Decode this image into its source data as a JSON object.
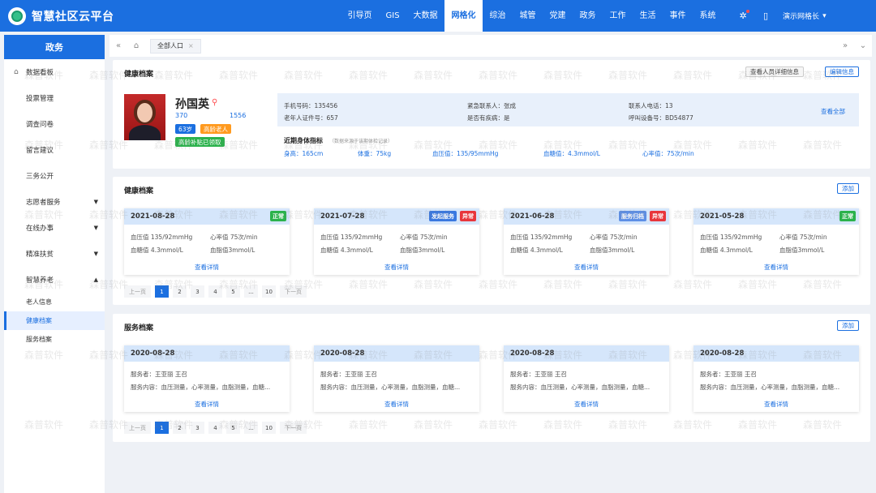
{
  "brand": {
    "title": "智慧社区云平台"
  },
  "nav": [
    "引导页",
    "GIS",
    "大数据",
    "网格化",
    "综治",
    "城管",
    "党建",
    "政务",
    "工作",
    "生活",
    "事件",
    "系统"
  ],
  "nav_active": 3,
  "user": {
    "name": "演示网格长"
  },
  "sidebar": {
    "head": "政务",
    "items": [
      {
        "label": "数据看板",
        "home": true
      },
      {
        "label": "投票管理"
      },
      {
        "label": "调查问卷"
      },
      {
        "label": "留言建议"
      },
      {
        "label": "三务公开"
      },
      {
        "label": "志愿者服务",
        "caret": "▼"
      },
      {
        "label": "在线办事",
        "caret": "▼"
      },
      {
        "label": "精准扶贫",
        "caret": "▼"
      },
      {
        "label": "智慧养老",
        "caret": "▲"
      }
    ],
    "sub_items": [
      "老人信息",
      "健康档案",
      "服务档案"
    ],
    "active_sub": 1
  },
  "tabbar": {
    "tab": "全部人口",
    "close": "×"
  },
  "profile": {
    "section_title": "健康档案",
    "btn_view": "查看人员详细信息",
    "btn_edit": "编辑信息",
    "name": "孙国英",
    "id_part1": "370",
    "id_part2": "1556",
    "tag_age": "63岁",
    "tag_elder": "高龄老人",
    "tag_subsidy": "高龄补贴已领取",
    "info": {
      "phone": "手机号码：135456",
      "elder_cert": "老年人证件号：657",
      "emergency": "紧急联系人：张成",
      "disease": "是否有疾病：是",
      "contact_phone": "联系人电话：13",
      "call_device": "呼叫设备号：BD54877",
      "view_all": "查看全部"
    },
    "recent_title": "近期身体指标",
    "recent_note": "（数据来源于该期体检记录）",
    "metrics": [
      "身高：165cm",
      "体重：75kg",
      "血压值：135/95mmHg",
      "血糖值：4.3mmol/L",
      "心率值：75次/min"
    ]
  },
  "health": {
    "title": "健康档案",
    "add": "添加",
    "cards": [
      {
        "date": "2021-08-28",
        "badges": [
          {
            "text": "正常",
            "color": "#2bb24c"
          }
        ]
      },
      {
        "date": "2021-07-28",
        "badges": [
          {
            "text": "发起服务",
            "color": "#3a78e0"
          },
          {
            "text": "异常",
            "color": "#e8363c"
          }
        ]
      },
      {
        "date": "2021-06-28",
        "badges": [
          {
            "text": "服务归档",
            "color": "#5d8fe6"
          },
          {
            "text": "异常",
            "color": "#e8363c"
          }
        ]
      },
      {
        "date": "2021-05-28",
        "badges": [
          {
            "text": "正常",
            "color": "#2bb24c"
          }
        ]
      }
    ],
    "bp": "血压值 135/92mmHg",
    "hr": "心率值 75次/min",
    "bs": "血糖值 4.3mmol/L",
    "bf": "血脂值3mmol/L",
    "link": "查看详情"
  },
  "service": {
    "title": "服务档案",
    "add": "添加",
    "dates": [
      "2020-08-28",
      "2020-08-28",
      "2020-08-28",
      "2020-08-28"
    ],
    "servant": "服务者：王亚丽 王召",
    "content": "服务内容：血压测量，心率测量，血脂测量，血糖...",
    "link": "查看详情"
  },
  "pager": {
    "prev": "上一页",
    "pages": [
      "1",
      "2",
      "3",
      "4",
      "5",
      "...",
      "10"
    ],
    "next": "下一页"
  },
  "watermark": "森普软件",
  "colors": {
    "primary": "#1b6fe0",
    "header_card": "#d5e6fb",
    "info_bg": "#e8f0fb",
    "elder_tag": "#ff9a1f",
    "subsidy_tag": "#2bb24c"
  }
}
